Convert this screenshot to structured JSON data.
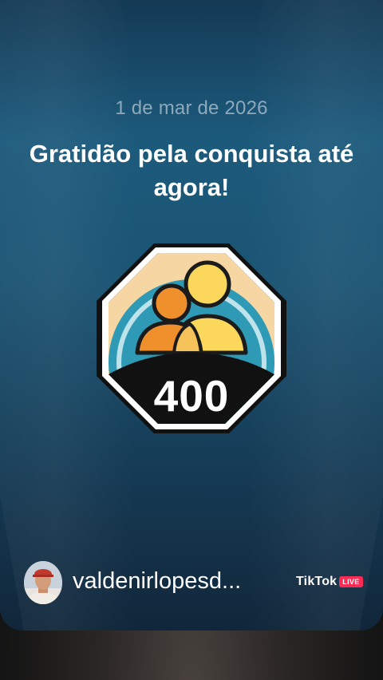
{
  "card": {
    "date": "1 de mar de 2026",
    "headline": "Gratidão pela conquista até agora!"
  },
  "badge": {
    "icon": "two-people-icon",
    "number": "400",
    "colors": {
      "outline": "#111111",
      "frame": "#ffffff",
      "sky": "#f6d6a3",
      "ring": "#2e9ab5",
      "person_left": "#f0902c",
      "person_right": "#fbd85c",
      "base": "#111111"
    }
  },
  "footer": {
    "username": "valdenirlopesd...",
    "avatar_icon": "user-avatar",
    "brand": "TikTok",
    "live_label": "LIVE",
    "live_color": "#fe2c55"
  }
}
